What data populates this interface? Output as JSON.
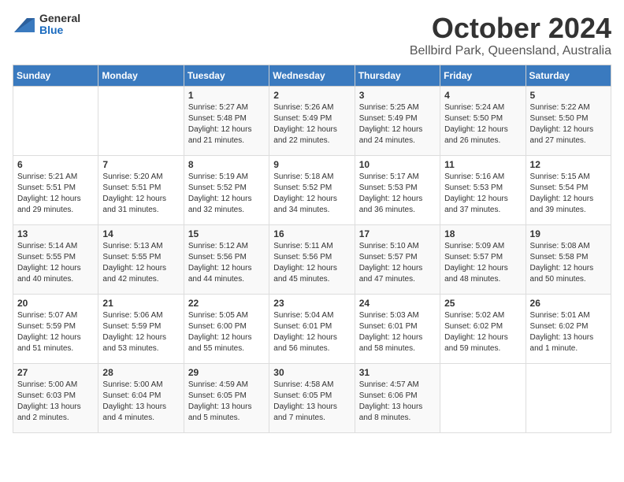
{
  "header": {
    "logo_general": "General",
    "logo_blue": "Blue",
    "month_title": "October 2024",
    "location": "Bellbird Park, Queensland, Australia"
  },
  "columns": [
    "Sunday",
    "Monday",
    "Tuesday",
    "Wednesday",
    "Thursday",
    "Friday",
    "Saturday"
  ],
  "weeks": [
    [
      {
        "day": "",
        "sunrise": "",
        "sunset": "",
        "daylight": ""
      },
      {
        "day": "",
        "sunrise": "",
        "sunset": "",
        "daylight": ""
      },
      {
        "day": "1",
        "sunrise": "Sunrise: 5:27 AM",
        "sunset": "Sunset: 5:48 PM",
        "daylight": "Daylight: 12 hours and 21 minutes."
      },
      {
        "day": "2",
        "sunrise": "Sunrise: 5:26 AM",
        "sunset": "Sunset: 5:49 PM",
        "daylight": "Daylight: 12 hours and 22 minutes."
      },
      {
        "day": "3",
        "sunrise": "Sunrise: 5:25 AM",
        "sunset": "Sunset: 5:49 PM",
        "daylight": "Daylight: 12 hours and 24 minutes."
      },
      {
        "day": "4",
        "sunrise": "Sunrise: 5:24 AM",
        "sunset": "Sunset: 5:50 PM",
        "daylight": "Daylight: 12 hours and 26 minutes."
      },
      {
        "day": "5",
        "sunrise": "Sunrise: 5:22 AM",
        "sunset": "Sunset: 5:50 PM",
        "daylight": "Daylight: 12 hours and 27 minutes."
      }
    ],
    [
      {
        "day": "6",
        "sunrise": "Sunrise: 5:21 AM",
        "sunset": "Sunset: 5:51 PM",
        "daylight": "Daylight: 12 hours and 29 minutes."
      },
      {
        "day": "7",
        "sunrise": "Sunrise: 5:20 AM",
        "sunset": "Sunset: 5:51 PM",
        "daylight": "Daylight: 12 hours and 31 minutes."
      },
      {
        "day": "8",
        "sunrise": "Sunrise: 5:19 AM",
        "sunset": "Sunset: 5:52 PM",
        "daylight": "Daylight: 12 hours and 32 minutes."
      },
      {
        "day": "9",
        "sunrise": "Sunrise: 5:18 AM",
        "sunset": "Sunset: 5:52 PM",
        "daylight": "Daylight: 12 hours and 34 minutes."
      },
      {
        "day": "10",
        "sunrise": "Sunrise: 5:17 AM",
        "sunset": "Sunset: 5:53 PM",
        "daylight": "Daylight: 12 hours and 36 minutes."
      },
      {
        "day": "11",
        "sunrise": "Sunrise: 5:16 AM",
        "sunset": "Sunset: 5:53 PM",
        "daylight": "Daylight: 12 hours and 37 minutes."
      },
      {
        "day": "12",
        "sunrise": "Sunrise: 5:15 AM",
        "sunset": "Sunset: 5:54 PM",
        "daylight": "Daylight: 12 hours and 39 minutes."
      }
    ],
    [
      {
        "day": "13",
        "sunrise": "Sunrise: 5:14 AM",
        "sunset": "Sunset: 5:55 PM",
        "daylight": "Daylight: 12 hours and 40 minutes."
      },
      {
        "day": "14",
        "sunrise": "Sunrise: 5:13 AM",
        "sunset": "Sunset: 5:55 PM",
        "daylight": "Daylight: 12 hours and 42 minutes."
      },
      {
        "day": "15",
        "sunrise": "Sunrise: 5:12 AM",
        "sunset": "Sunset: 5:56 PM",
        "daylight": "Daylight: 12 hours and 44 minutes."
      },
      {
        "day": "16",
        "sunrise": "Sunrise: 5:11 AM",
        "sunset": "Sunset: 5:56 PM",
        "daylight": "Daylight: 12 hours and 45 minutes."
      },
      {
        "day": "17",
        "sunrise": "Sunrise: 5:10 AM",
        "sunset": "Sunset: 5:57 PM",
        "daylight": "Daylight: 12 hours and 47 minutes."
      },
      {
        "day": "18",
        "sunrise": "Sunrise: 5:09 AM",
        "sunset": "Sunset: 5:57 PM",
        "daylight": "Daylight: 12 hours and 48 minutes."
      },
      {
        "day": "19",
        "sunrise": "Sunrise: 5:08 AM",
        "sunset": "Sunset: 5:58 PM",
        "daylight": "Daylight: 12 hours and 50 minutes."
      }
    ],
    [
      {
        "day": "20",
        "sunrise": "Sunrise: 5:07 AM",
        "sunset": "Sunset: 5:59 PM",
        "daylight": "Daylight: 12 hours and 51 minutes."
      },
      {
        "day": "21",
        "sunrise": "Sunrise: 5:06 AM",
        "sunset": "Sunset: 5:59 PM",
        "daylight": "Daylight: 12 hours and 53 minutes."
      },
      {
        "day": "22",
        "sunrise": "Sunrise: 5:05 AM",
        "sunset": "Sunset: 6:00 PM",
        "daylight": "Daylight: 12 hours and 55 minutes."
      },
      {
        "day": "23",
        "sunrise": "Sunrise: 5:04 AM",
        "sunset": "Sunset: 6:01 PM",
        "daylight": "Daylight: 12 hours and 56 minutes."
      },
      {
        "day": "24",
        "sunrise": "Sunrise: 5:03 AM",
        "sunset": "Sunset: 6:01 PM",
        "daylight": "Daylight: 12 hours and 58 minutes."
      },
      {
        "day": "25",
        "sunrise": "Sunrise: 5:02 AM",
        "sunset": "Sunset: 6:02 PM",
        "daylight": "Daylight: 12 hours and 59 minutes."
      },
      {
        "day": "26",
        "sunrise": "Sunrise: 5:01 AM",
        "sunset": "Sunset: 6:02 PM",
        "daylight": "Daylight: 13 hours and 1 minute."
      }
    ],
    [
      {
        "day": "27",
        "sunrise": "Sunrise: 5:00 AM",
        "sunset": "Sunset: 6:03 PM",
        "daylight": "Daylight: 13 hours and 2 minutes."
      },
      {
        "day": "28",
        "sunrise": "Sunrise: 5:00 AM",
        "sunset": "Sunset: 6:04 PM",
        "daylight": "Daylight: 13 hours and 4 minutes."
      },
      {
        "day": "29",
        "sunrise": "Sunrise: 4:59 AM",
        "sunset": "Sunset: 6:05 PM",
        "daylight": "Daylight: 13 hours and 5 minutes."
      },
      {
        "day": "30",
        "sunrise": "Sunrise: 4:58 AM",
        "sunset": "Sunset: 6:05 PM",
        "daylight": "Daylight: 13 hours and 7 minutes."
      },
      {
        "day": "31",
        "sunrise": "Sunrise: 4:57 AM",
        "sunset": "Sunset: 6:06 PM",
        "daylight": "Daylight: 13 hours and 8 minutes."
      },
      {
        "day": "",
        "sunrise": "",
        "sunset": "",
        "daylight": ""
      },
      {
        "day": "",
        "sunrise": "",
        "sunset": "",
        "daylight": ""
      }
    ]
  ]
}
